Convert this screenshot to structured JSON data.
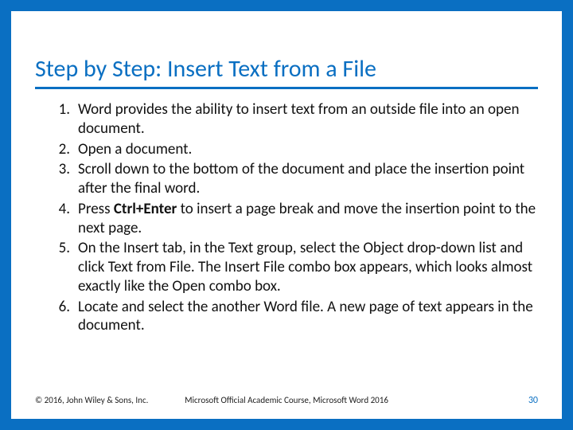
{
  "title": "Step by Step: Insert Text from a File",
  "steps": [
    [
      {
        "t": "Word provides the ability to insert text from an outside file into an open document."
      }
    ],
    [
      {
        "t": "Open a document."
      }
    ],
    [
      {
        "t": "Scroll down to the bottom of the document and place the insertion point after the final word."
      }
    ],
    [
      {
        "t": "Press "
      },
      {
        "t": "Ctrl+Enter",
        "b": true
      },
      {
        "t": " to insert a page break and move the insertion point to the next page."
      }
    ],
    [
      {
        "t": "On the Insert tab, in the Text group, select the Object drop-down list and click Text from File. The Insert File combo box appears, which looks almost exactly like the Open combo box."
      }
    ],
    [
      {
        "t": "Locate and select the another Word file. A new page of text appears in the document."
      }
    ]
  ],
  "footer": {
    "copyright": "© 2016, John Wiley & Sons, Inc.",
    "course": "Microsoft Official Academic Course, Microsoft Word 2016",
    "page": "30"
  }
}
